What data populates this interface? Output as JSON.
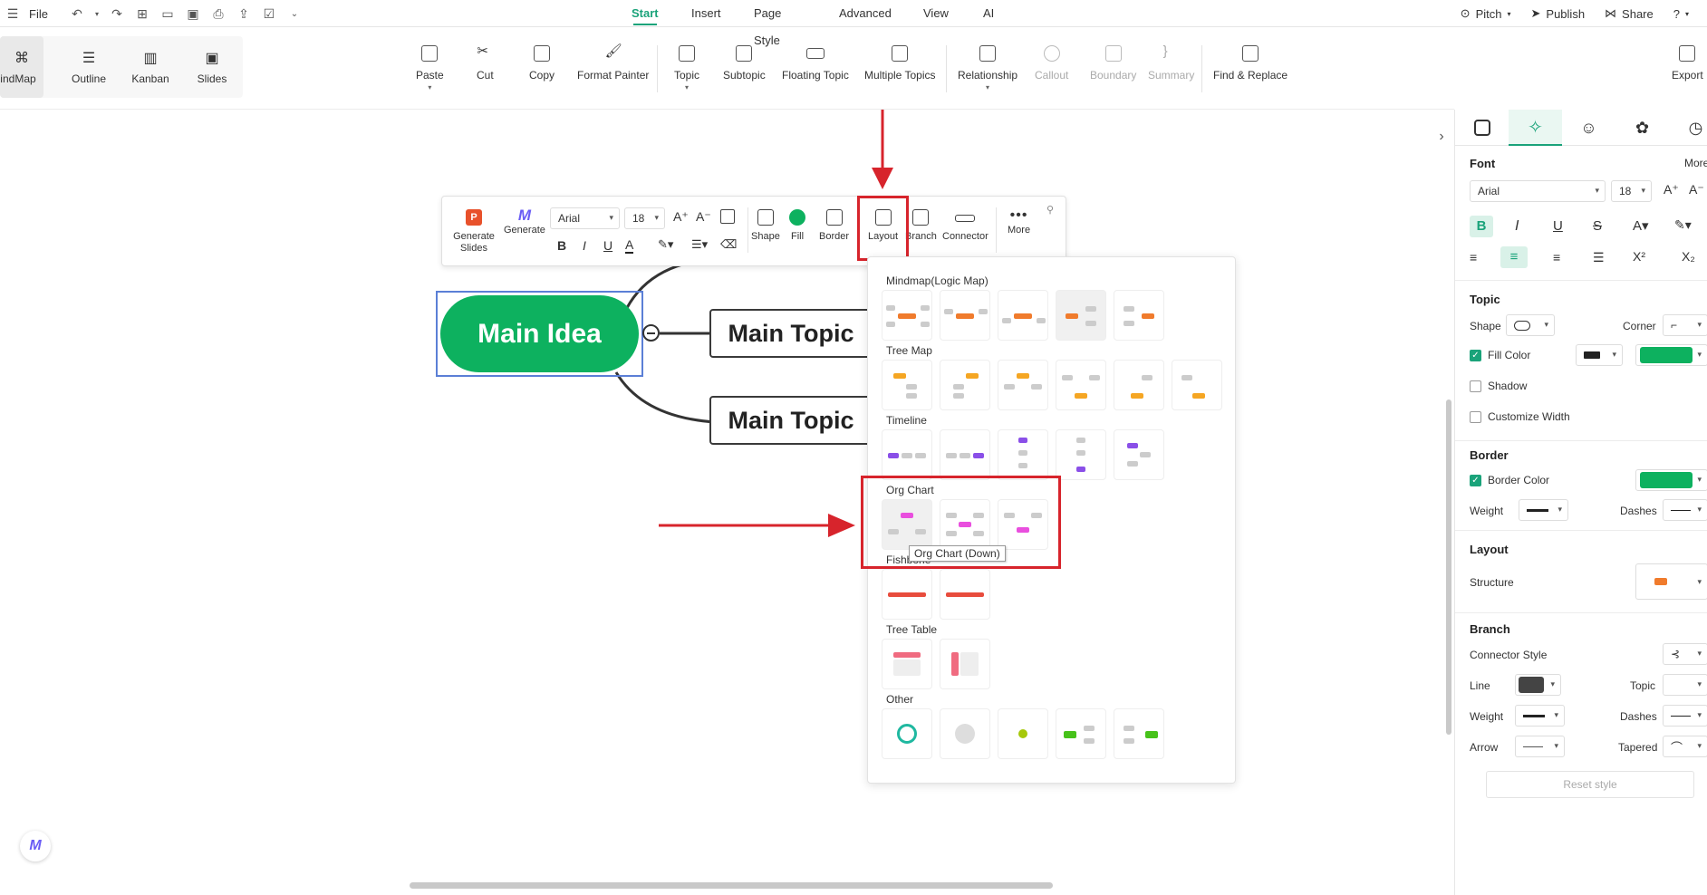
{
  "menubar": {
    "file": "File",
    "tabs": [
      "Start",
      "Insert",
      "Page Style",
      "Advanced",
      "View",
      "AI"
    ],
    "active_tab": "Start",
    "pitch": "Pitch",
    "publish": "Publish",
    "share": "Share"
  },
  "views": [
    "MindMap",
    "Outline",
    "Kanban",
    "Slides"
  ],
  "ribbon": {
    "paste": "Paste",
    "cut": "Cut",
    "copy": "Copy",
    "format_painter": "Format Painter",
    "topic": "Topic",
    "subtopic": "Subtopic",
    "floating_topic": "Floating Topic",
    "multiple_topics": "Multiple Topics",
    "relationship": "Relationship",
    "callout": "Callout",
    "boundary": "Boundary",
    "summary": "Summary",
    "find_replace": "Find & Replace",
    "export": "Export"
  },
  "canvas": {
    "main_idea": "Main Idea",
    "main_topic_1": "Main Topic",
    "main_topic_2": "Main Topic",
    "main_idea_color": "#0db15f"
  },
  "float_toolbar": {
    "generate_slides": "Generate Slides",
    "generate": "Generate",
    "font": "Arial",
    "size": "18",
    "bold": "B",
    "italic": "I",
    "underline": "U",
    "font_color": "A",
    "shape": "Shape",
    "fill": "Fill",
    "border": "Border",
    "layout": "Layout",
    "branch": "Branch",
    "connector": "Connector",
    "more": "More"
  },
  "layout_panel": {
    "sections": [
      "Mindmap(Logic Map)",
      "Tree Map",
      "Timeline",
      "Org Chart",
      "Fishbone",
      "Tree Table",
      "Other"
    ],
    "tooltip": "Org Chart (Down)"
  },
  "right_panel": {
    "font_header": "Font",
    "more": "More",
    "font": "Arial",
    "size": "18",
    "topic_header": "Topic",
    "shape": "Shape",
    "corner": "Corner",
    "fill_color": "Fill Color",
    "shadow": "Shadow",
    "customize_width": "Customize Width",
    "border_header": "Border",
    "border_color": "Border Color",
    "weight": "Weight",
    "dashes": "Dashes",
    "layout_header": "Layout",
    "structure": "Structure",
    "branch_header": "Branch",
    "connector_style": "Connector Style",
    "line": "Line",
    "topic": "Topic",
    "weight2": "Weight",
    "dashes2": "Dashes",
    "arrow": "Arrow",
    "tapered": "Tapered",
    "reset_style": "Reset style",
    "accent": "#0db15f"
  }
}
